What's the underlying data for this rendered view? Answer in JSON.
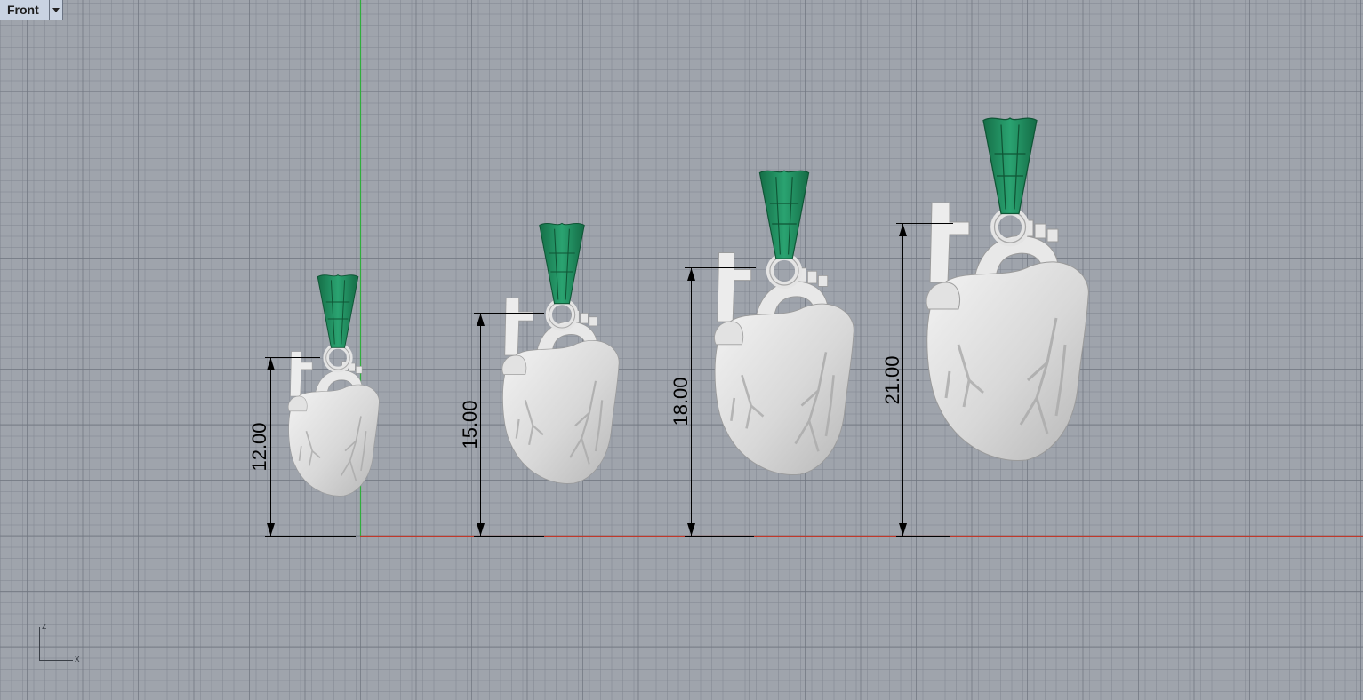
{
  "viewport": {
    "title": "Front"
  },
  "dimensions": [
    {
      "label": "12.00"
    },
    {
      "label": "15.00"
    },
    {
      "label": "18.00"
    },
    {
      "label": "21.00"
    }
  ],
  "axes": {
    "x": "x",
    "z": "z"
  },
  "colors": {
    "grid_background": "#9fa4ac",
    "x_axis": "#c0392b",
    "z_axis": "#2fae3b",
    "bail": "#1f8a5c",
    "model": "#e0e0e0"
  }
}
